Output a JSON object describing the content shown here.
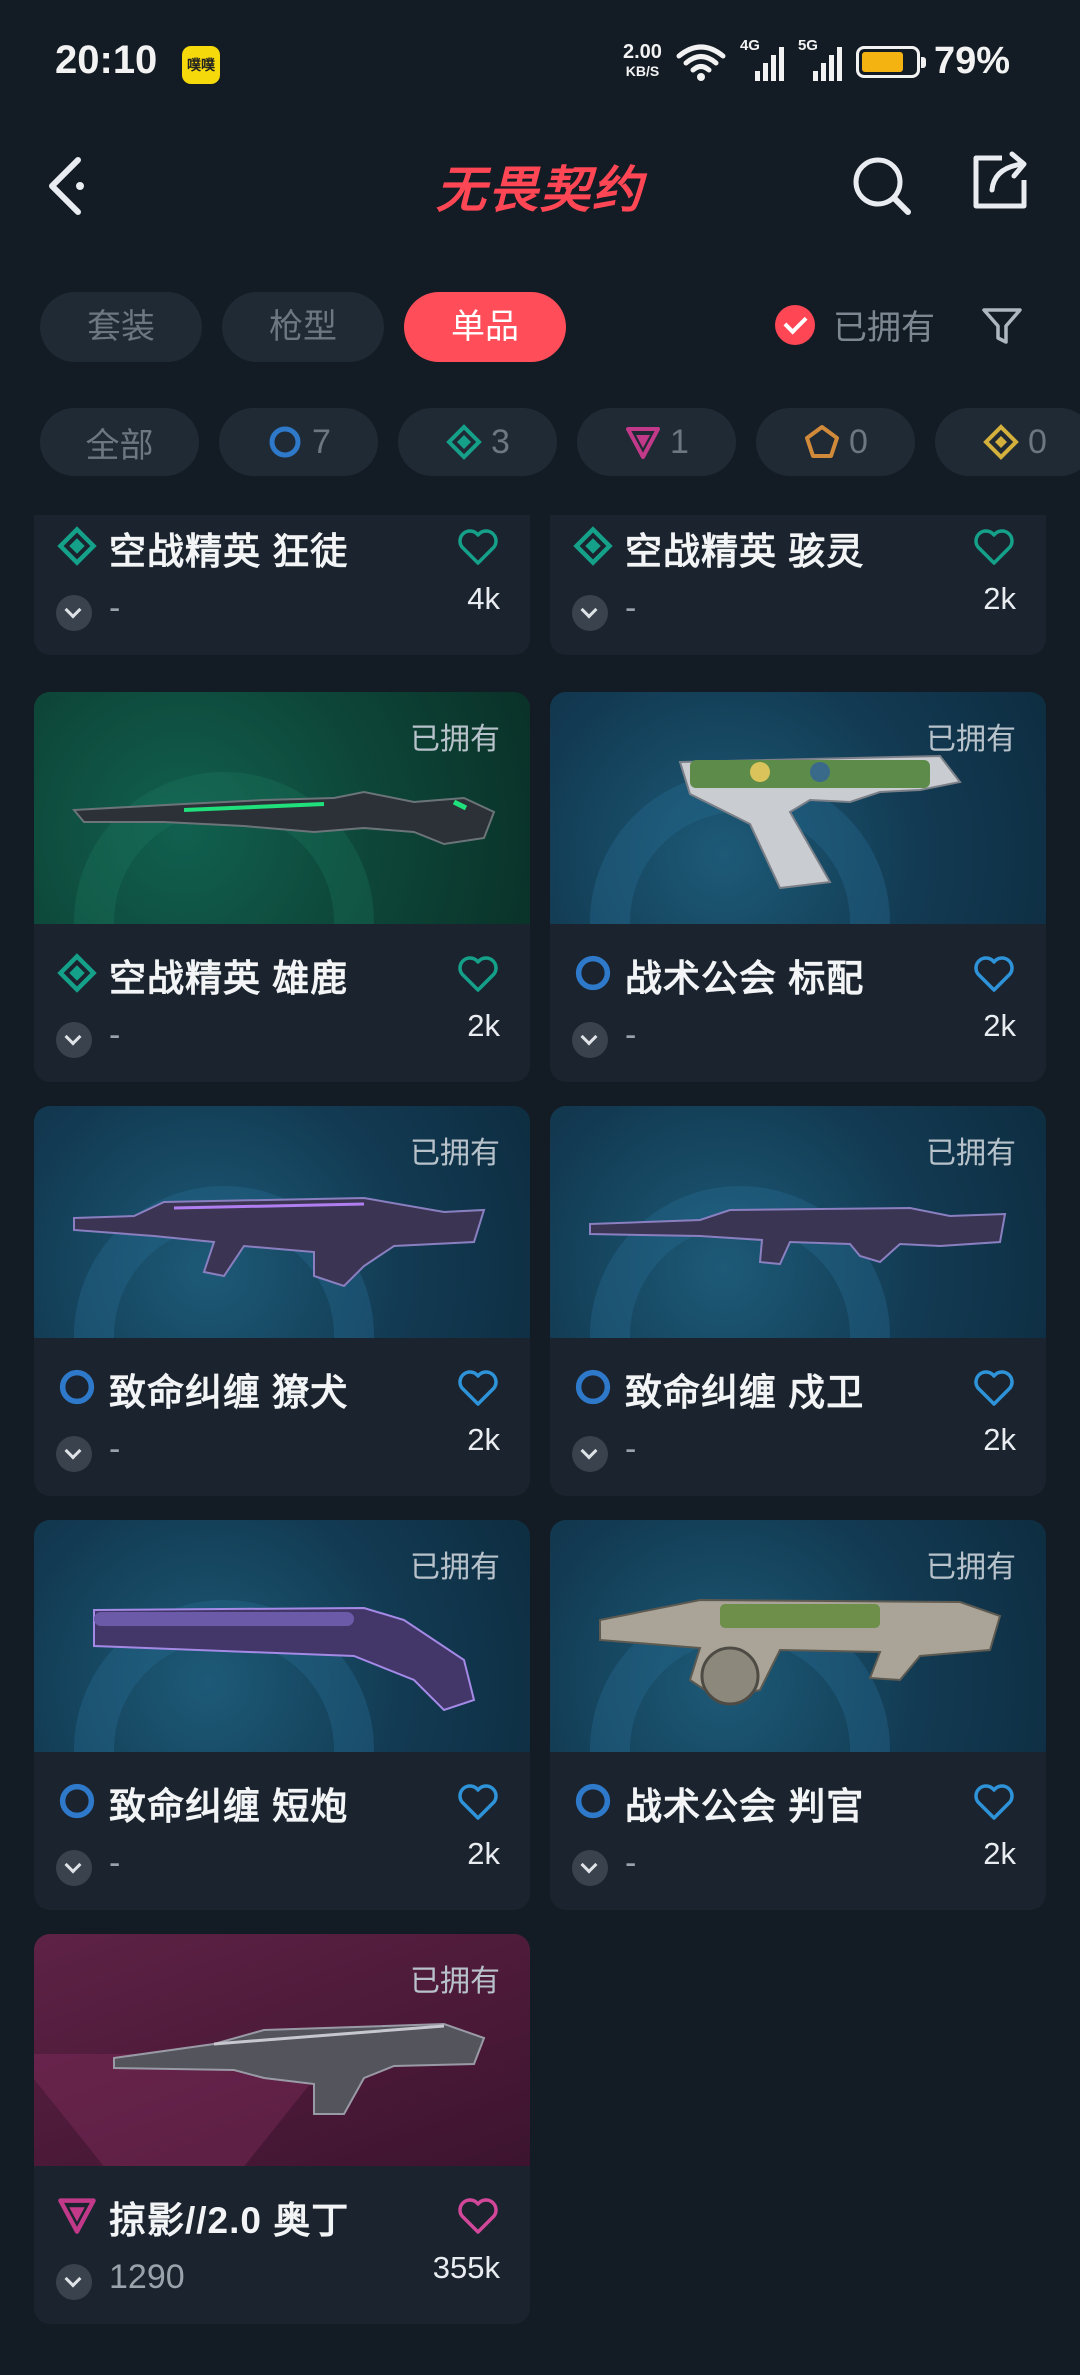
{
  "status_bar": {
    "time": "20:10",
    "app_icon_text": "噗噗",
    "net_speed": "2.00",
    "net_speed_unit": "KB/S",
    "signal1": "4G",
    "signal2": "5G",
    "battery_level": 0.79,
    "battery_pct": "79%"
  },
  "header": {
    "logo_text": "无畏契约",
    "back_icon": "chevron-left-icon",
    "search_icon": "search-icon",
    "share_icon": "share-icon"
  },
  "tabs": [
    {
      "label": "套装",
      "active": false
    },
    {
      "label": "枪型",
      "active": false
    },
    {
      "label": "单品",
      "active": true
    }
  ],
  "owned_filter": {
    "label": "已拥有",
    "checked": true
  },
  "chips": [
    {
      "label": "全部",
      "count": ""
    },
    {
      "tier": "select",
      "color": "#2e79c9",
      "count": "7"
    },
    {
      "tier": "deluxe",
      "color": "#15a08a",
      "count": "3"
    },
    {
      "tier": "premium",
      "color": "#c2398a",
      "count": "1"
    },
    {
      "tier": "exclusive",
      "color": "#d08a3a",
      "count": "0"
    },
    {
      "tier": "ultra",
      "color": "#d4b03d",
      "count": "0"
    }
  ],
  "skins": [
    {
      "name": "空战精英 狂徒",
      "tier": "deluxe",
      "price": "-",
      "popularity": "4k",
      "owned": "",
      "bg": "none"
    },
    {
      "name": "空战精英 骇灵",
      "tier": "deluxe",
      "price": "-",
      "popularity": "2k",
      "owned": "",
      "bg": "none"
    },
    {
      "name": "空战精英 雄鹿",
      "tier": "deluxe",
      "price": "-",
      "popularity": "2k",
      "owned": "已拥有",
      "bg": "green"
    },
    {
      "name": "战术公会 标配",
      "tier": "select",
      "price": "-",
      "popularity": "2k",
      "owned": "已拥有",
      "bg": "teal"
    },
    {
      "name": "致命纠缠 獠犬",
      "tier": "select",
      "price": "-",
      "popularity": "2k",
      "owned": "已拥有",
      "bg": "teal"
    },
    {
      "name": "致命纠缠 戍卫",
      "tier": "select",
      "price": "-",
      "popularity": "2k",
      "owned": "已拥有",
      "bg": "teal"
    },
    {
      "name": "致命纠缠 短炮",
      "tier": "select",
      "price": "-",
      "popularity": "2k",
      "owned": "已拥有",
      "bg": "teal"
    },
    {
      "name": "战术公会 判官",
      "tier": "select",
      "price": "-",
      "popularity": "2k",
      "owned": "已拥有",
      "bg": "teal"
    },
    {
      "name": "掠影//2.0 奥丁",
      "tier": "premium",
      "price": "1290",
      "popularity": "355k",
      "owned": "已拥有",
      "bg": "magenta"
    }
  ]
}
